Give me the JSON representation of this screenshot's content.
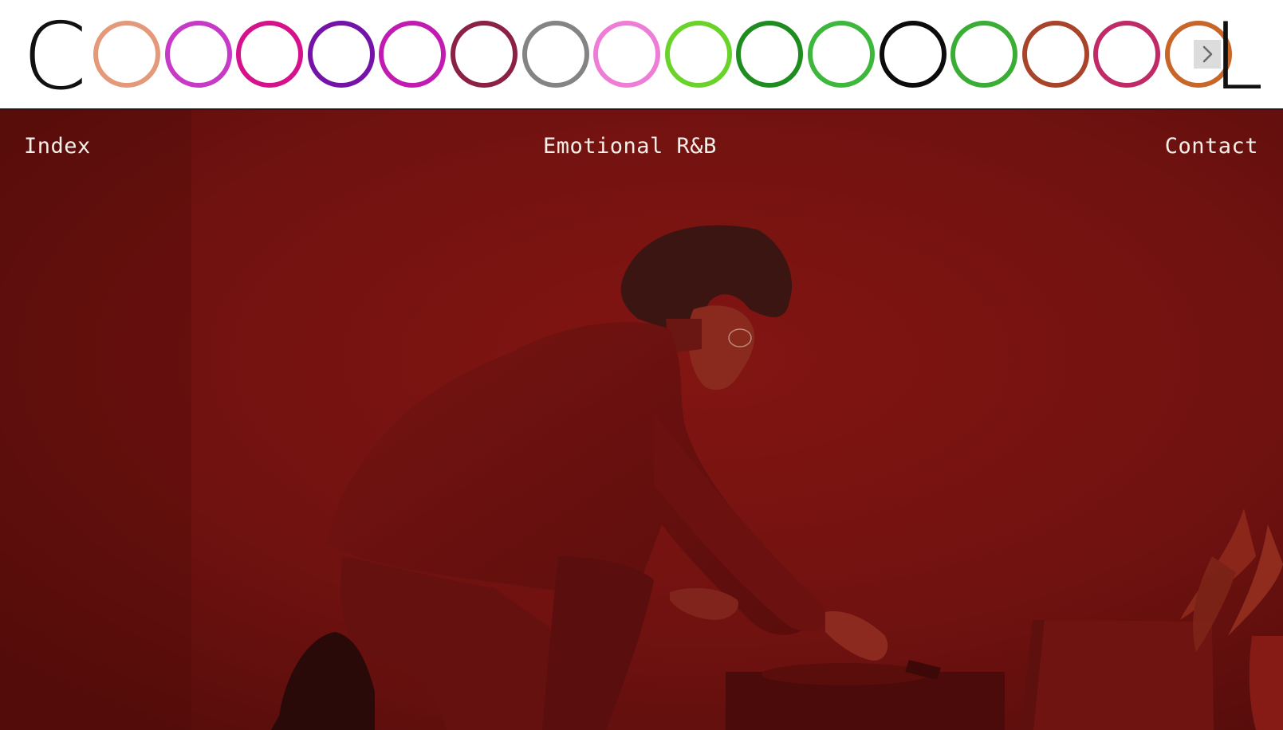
{
  "header": {
    "logo_first_letter": "C",
    "logo_last_letter": "L",
    "ring_colors": [
      "#e49a7a",
      "#c63ac7",
      "#d5128c",
      "#7513a8",
      "#c21bb2",
      "#8c2148",
      "#848484",
      "#ee7dd6",
      "#6ad32a",
      "#1f8c1f",
      "#3db83d",
      "#0c0c0c",
      "#3aae34",
      "#a8442a",
      "#c02a66",
      "#c8662a"
    ],
    "next_icon": "chevron-right-icon"
  },
  "nav": {
    "index_label": "Index",
    "genre_label": "Emotional R&B",
    "contact_label": "Contact"
  },
  "hero": {
    "background_color": "#6f1210"
  }
}
